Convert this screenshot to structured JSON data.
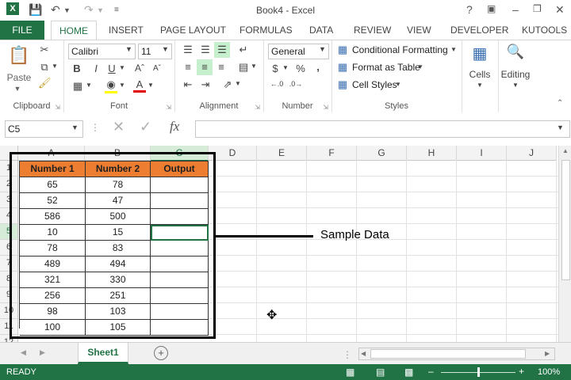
{
  "title": "Book4 - Excel",
  "tabs": [
    "FILE",
    "HOME",
    "INSERT",
    "PAGE LAYOUT",
    "FORMULAS",
    "DATA",
    "REVIEW",
    "VIEW",
    "DEVELOPER",
    "KUTOOLS"
  ],
  "ribbon": {
    "paste": "Paste",
    "font_name": "Calibri",
    "font_size": "11",
    "number_format": "General",
    "conditional_formatting": "Conditional Formatting",
    "format_as_table": "Format as Table",
    "cell_styles": "Cell Styles",
    "cells": "Cells",
    "editing": "Editing",
    "groups": [
      "Clipboard",
      "Font",
      "Alignment",
      "Number",
      "Styles"
    ],
    "bold": "B",
    "italic": "I",
    "underline": "U",
    "currency": "$",
    "percent": "%",
    "comma": ","
  },
  "name_box": "C5",
  "formula": "",
  "columns": [
    "A",
    "B",
    "C",
    "D",
    "E",
    "F",
    "G",
    "H",
    "I",
    "J"
  ],
  "rows": [
    "1",
    "2",
    "3",
    "4",
    "5",
    "6",
    "7",
    "8",
    "9",
    "10",
    "11",
    "12"
  ],
  "table": {
    "headers": [
      "Number 1",
      "Number 2",
      "Output"
    ],
    "rows": [
      [
        "65",
        "78",
        ""
      ],
      [
        "52",
        "47",
        ""
      ],
      [
        "586",
        "500",
        ""
      ],
      [
        "10",
        "15",
        ""
      ],
      [
        "78",
        "83",
        ""
      ],
      [
        "489",
        "494",
        ""
      ],
      [
        "321",
        "330",
        ""
      ],
      [
        "256",
        "251",
        ""
      ],
      [
        "98",
        "103",
        ""
      ],
      [
        "100",
        "105",
        ""
      ]
    ]
  },
  "annotation": "Sample Data",
  "sheet_tab": "Sheet1",
  "status": {
    "ready": "READY",
    "zoom": "100%",
    "zoom_level_percent": 100
  },
  "colors": {
    "excel_green": "#217346",
    "header_fill": "#ed7d31"
  }
}
